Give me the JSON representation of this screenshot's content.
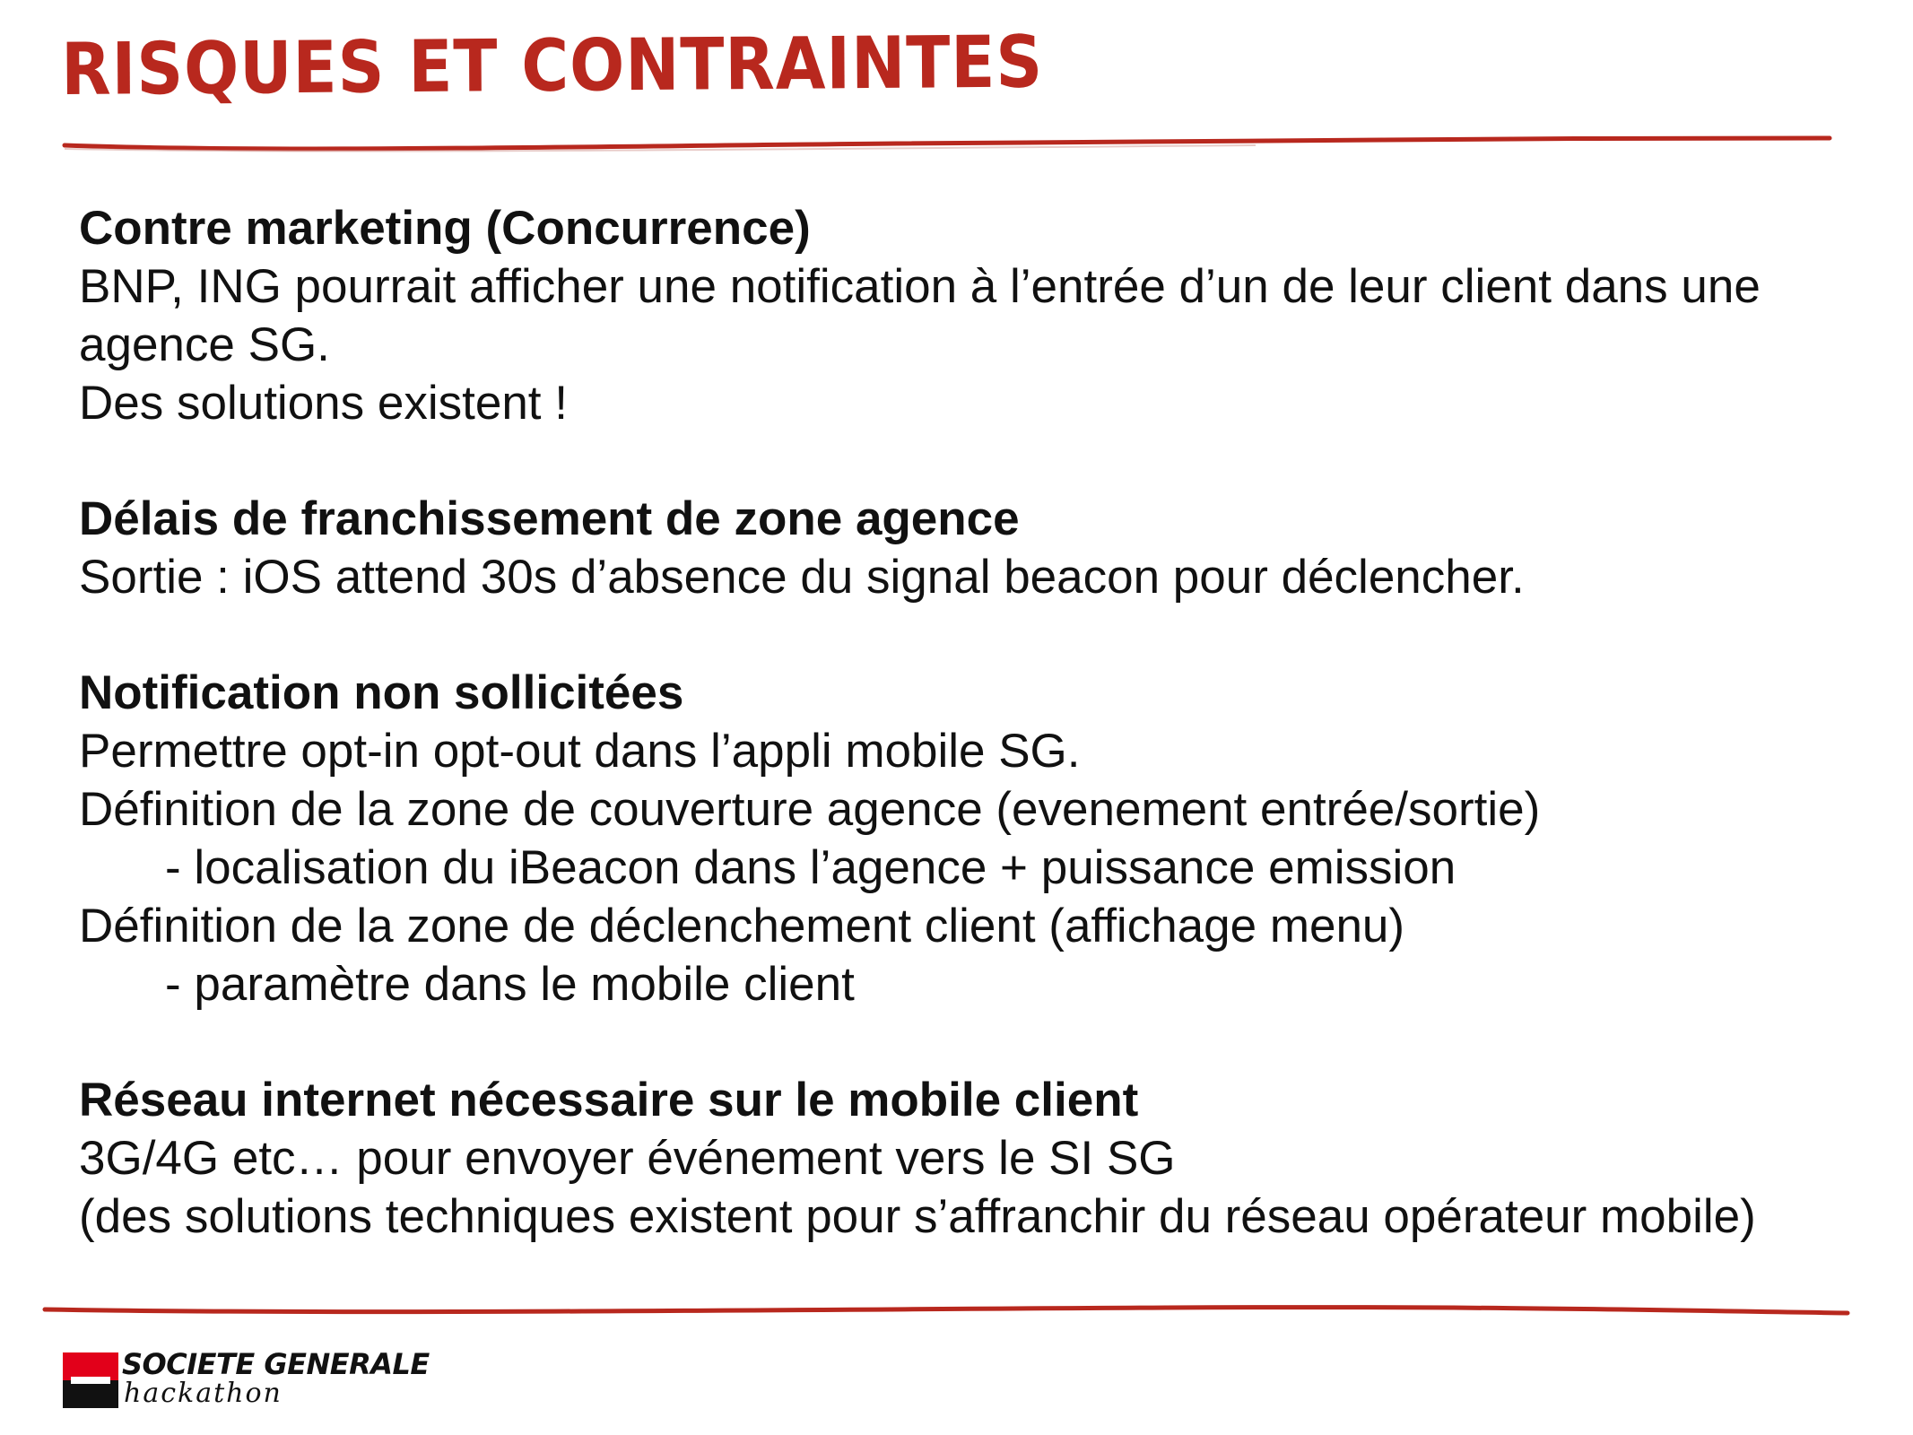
{
  "slide": {
    "title": "RISQUES ET CONTRAINTES"
  },
  "sections": [
    {
      "heading": "Contre marketing (Concurrence)",
      "lines": [
        "BNP, ING pourrait afficher une notification à l’entrée d’un de leur client dans une",
        "agence SG.",
        "Des solutions existent !"
      ]
    },
    {
      "heading": "Délais de franchissement de zone agence",
      "lines": [
        "Sortie : iOS attend 30s d’absence du signal beacon pour déclencher."
      ]
    },
    {
      "heading": "Notification non sollicitées",
      "lines": [
        "Permettre opt-in opt-out dans l’appli mobile SG.",
        "Définition de la zone de couverture agence (evenement entrée/sortie)",
        "- localisation du iBeacon dans l’agence + puissance emission",
        "Définition de la zone de déclenchement client (affichage menu)",
        "- paramètre dans le mobile client"
      ]
    },
    {
      "heading": "Réseau internet nécessaire sur le mobile client",
      "lines": [
        "3G/4G etc… pour envoyer événement vers le SI SG",
        "(des solutions techniques existent pour s’affranchir du réseau opérateur mobile)"
      ]
    }
  ],
  "footer": {
    "logo_name": "SOCIETE GENERALE",
    "logo_sub": "hackathon"
  },
  "colors": {
    "title_red": "#b8281e",
    "rule_red": "#b8281e",
    "logo_red": "#e2001a"
  }
}
